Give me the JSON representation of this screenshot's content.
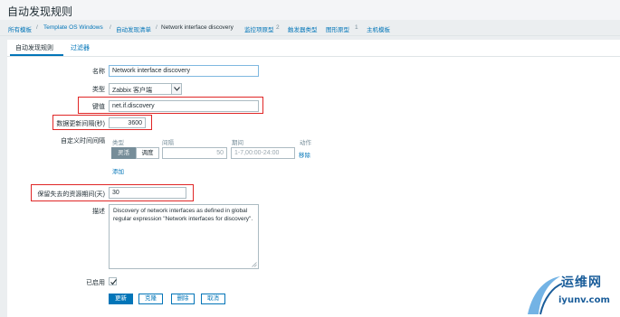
{
  "page": {
    "title": "自动发现规则"
  },
  "breadcrumb": {
    "all_templates": "所有模板",
    "separator": "/",
    "template": "Template OS Windows",
    "discovery_list": "自动发现清单",
    "current": "Network interface discovery",
    "item_prototypes": "监控项原型",
    "item_prototypes_count": "2",
    "trigger_prototypes": "触发器类型",
    "graph_prototypes": "图形原型",
    "graph_prototypes_count": "1",
    "host_prototypes": "主机模板"
  },
  "tabs": [
    {
      "label": "自动发现规则",
      "active": true
    },
    {
      "label": "过滤器",
      "active": false
    }
  ],
  "form": {
    "name_label": "名称",
    "name_value": "Network interface discovery",
    "type_label": "类型",
    "type_value": "Zabbix 客户端",
    "key_label": "键值",
    "key_value": "net.if.discovery",
    "interval_label": "数据更新间隔(秒)",
    "interval_value": "3600",
    "custom_intervals_label": "自定义时间间隔",
    "schedule": {
      "col_type": "类型",
      "col_interval": "间隔",
      "col_period": "期间",
      "col_action": "动作",
      "flexible": "灵活",
      "scheduling": "调度",
      "interval_value": "50",
      "period_placeholder": "1-7,00:00-24:00",
      "remove": "移除",
      "add": "添加"
    },
    "keep_lost_label": "保留失去的资源期间(天)",
    "keep_lost_value": "30",
    "description_label": "描述",
    "description_value": "Discovery of network interfaces as defined in global regular expression \"Network interfaces for discovery\".",
    "enabled_label": "已启用",
    "enabled": true
  },
  "buttons": {
    "update": "更新",
    "clone": "克隆",
    "delete": "删除",
    "cancel": "取消"
  },
  "watermark": {
    "text1": "运维网",
    "text2": "iyunv.com"
  },
  "colors": {
    "accent": "#0275b8",
    "highlight": "#e02626",
    "background": "#ebeef0"
  }
}
